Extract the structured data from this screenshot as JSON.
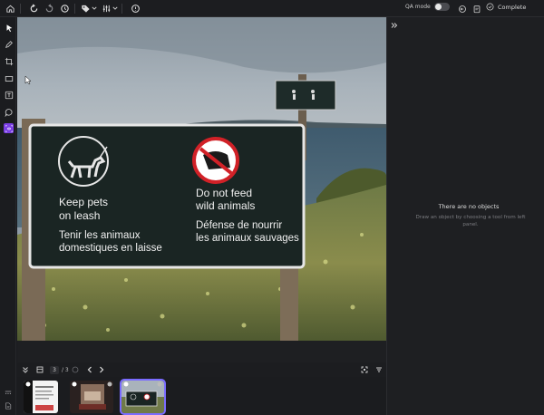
{
  "topbar": {
    "icons": [
      "home-icon",
      "undo-icon",
      "redo-icon",
      "history-icon",
      "tag-icon",
      "chevron-down-icon",
      "adjust-icon",
      "chevron-down-icon",
      "comment-icon"
    ],
    "qa_mode_label": "QA mode",
    "qa_mode_on": false,
    "complete_label": "Complete"
  },
  "left_tools": [
    "select-icon",
    "pen-icon",
    "crop-icon",
    "rectangle-icon",
    "text-icon",
    "comment-icon",
    "ai-tool-icon"
  ],
  "canvas": {
    "sign": {
      "left_en_1": "Keep pets",
      "left_en_2": "on leash",
      "left_fr_1": "Tenir les animaux",
      "left_fr_2": "domestiques en laisse",
      "right_en_1": "Do not feed",
      "right_en_2": "wild animals",
      "right_fr_1": "Défense de nourrir",
      "right_fr_2": "les animaux sauvages"
    }
  },
  "pagination": {
    "current_page": "3",
    "total_label": "/ 3"
  },
  "right_panel": {
    "empty_title": "There are no objects",
    "empty_subtitle": "Draw an object by choosing a tool from left panel."
  },
  "colors": {
    "accent": "#7b3fe4",
    "selection": "#7a6cff",
    "background": "#1b1c1f"
  }
}
